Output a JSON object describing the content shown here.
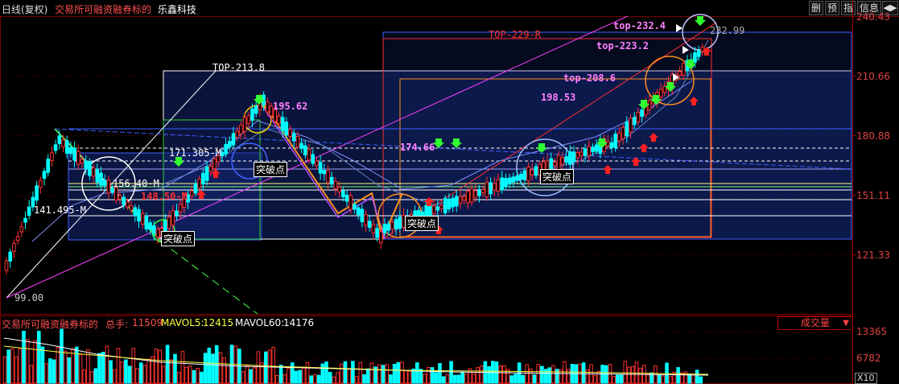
{
  "header": {
    "period": "日线(复权)",
    "indicator_name": "交易所可融资融券标的",
    "stock_name": "乐鑫科技",
    "buttons": [
      "删",
      "预",
      "指",
      "信息"
    ],
    "arrow": "◀▶"
  },
  "price_axis": [
    "240.43",
    "210.66",
    "180.88",
    "151.11",
    "121.33"
  ],
  "annotations": {
    "low": "99.00",
    "high": "232.99",
    "top_213": "TOP-213.8",
    "top_229": "TOP-229-R",
    "top_232": "top-232.4",
    "top_223": "top-223.2",
    "top_208": "top-208.6",
    "v_198": "198.53",
    "v_195": "195.62",
    "v_174": "174.66",
    "v_171": "171.305-M",
    "v_156": "156.40-M",
    "v_148": "148.50-M",
    "v_141": "141.495-M",
    "breakout": "突破点"
  },
  "volume": {
    "indicator_name": "交易所可融资融券标的",
    "total_label": "总手:",
    "total_value": "11509",
    "ma5_label": "MAVOL5:",
    "ma5_value": "12415",
    "ma60_label": "MAVOL60:",
    "ma60_value": "14176",
    "selector": "成交量",
    "axis": [
      "13365",
      "6782"
    ],
    "scale": "X10"
  },
  "colors": {
    "up": "#ff3030",
    "down": "#00ffff",
    "bg": "#000000",
    "frame": "#800000"
  }
}
